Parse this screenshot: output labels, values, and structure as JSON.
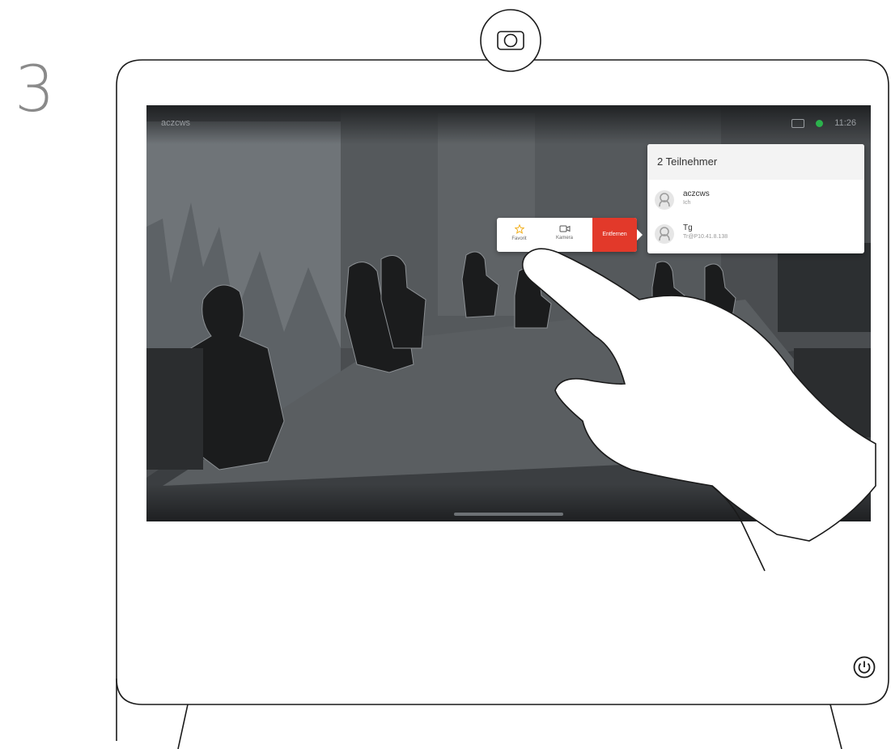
{
  "step": {
    "number": "3"
  },
  "call": {
    "status_left": "aczcws",
    "clock": "11:26"
  },
  "participants": {
    "header": "2 Teilnehmer",
    "items": [
      {
        "name": "aczcws",
        "subtitle": "Ich"
      },
      {
        "name": "Tg",
        "subtitle": "Tr@P10.41.8.138"
      }
    ]
  },
  "actions": {
    "favorite_label": "Favorit",
    "camera_label": "Kamera",
    "remove_label": "Entfernen"
  },
  "colors": {
    "remove_red": "#e2392a",
    "favorite_yellow": "#f2b01e",
    "status_green": "#2bb24c"
  },
  "icons": {
    "device": "webcam-icon",
    "power": "power-icon",
    "favorite": "star-icon",
    "camera": "video-camera-icon"
  }
}
